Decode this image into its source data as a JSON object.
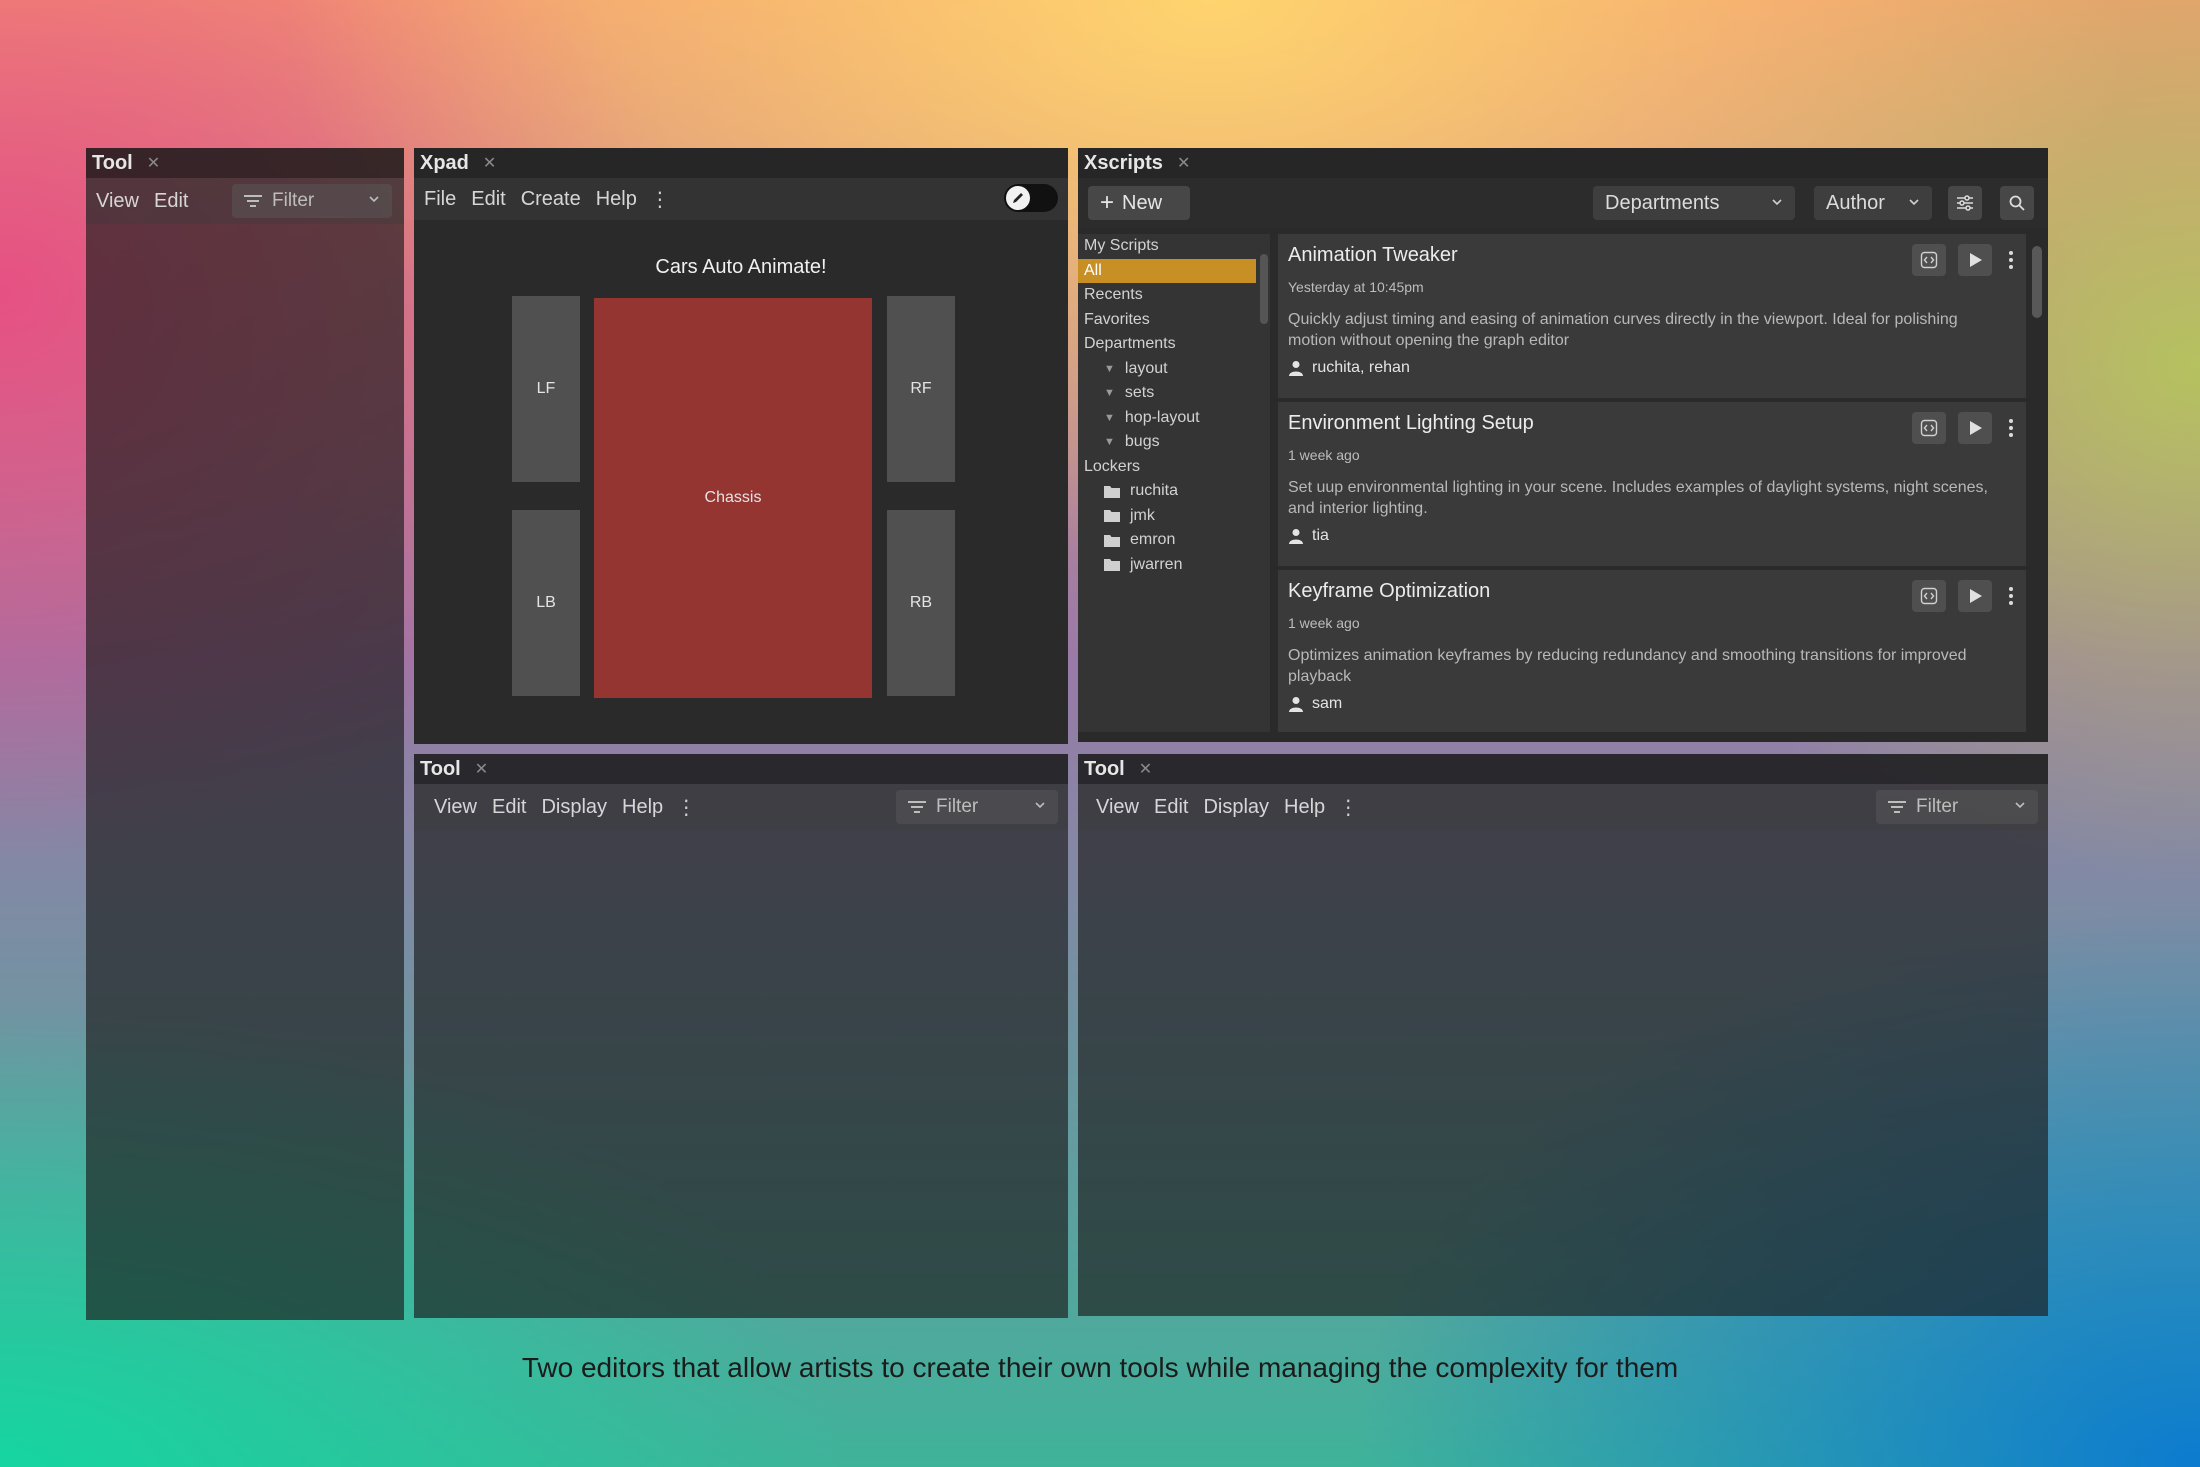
{
  "tool_left": {
    "title": "Tool",
    "menu": [
      "View",
      "Edit"
    ],
    "filter_label": "Filter"
  },
  "xpad": {
    "title": "Xpad",
    "menu": [
      "File",
      "Edit",
      "Create",
      "Help"
    ],
    "canvas_title": "Cars Auto Animate!",
    "wheels": {
      "lf": "LF",
      "rf": "RF",
      "lb": "LB",
      "rb": "RB"
    },
    "chassis": "Chassis",
    "chassis_color": "#943532"
  },
  "xscripts": {
    "title": "Xscripts",
    "new_label": "New",
    "departments_label": "Departments",
    "author_label": "Author",
    "accent_color": "#c88f24",
    "sidebar": {
      "my_scripts": "My Scripts",
      "all": "All",
      "recents": "Recents",
      "favorites": "Favorites",
      "departments": "Departments",
      "department_items": [
        "layout",
        "sets",
        "hop-layout",
        "bugs"
      ],
      "lockers": "Lockers",
      "locker_items": [
        "ruchita",
        "jmk",
        "emron",
        "jwarren"
      ]
    },
    "scripts": [
      {
        "title": "Animation Tweaker",
        "time": "Yesterday at 10:45pm",
        "description": "Quickly adjust timing and easing of animation curves directly in the viewport. Ideal for polishing motion without opening the graph editor",
        "authors": "ruchita, rehan"
      },
      {
        "title": "Environment Lighting Setup",
        "time": "1 week ago",
        "description": "Set uup environmental lighting in your scene. Includes examples of daylight systems, night scenes, and interior lighting.",
        "authors": "tia"
      },
      {
        "title": "Keyframe Optimization",
        "time": "1 week ago",
        "description": "Optimizes animation keyframes by reducing redundancy and smoothing transitions for improved playback",
        "authors": "sam"
      }
    ]
  },
  "tool_bottom_left": {
    "title": "Tool",
    "menu": [
      "View",
      "Edit",
      "Display",
      "Help"
    ],
    "filter_label": "Filter"
  },
  "tool_bottom_right": {
    "title": "Tool",
    "menu": [
      "View",
      "Edit",
      "Display",
      "Help"
    ],
    "filter_label": "Filter"
  },
  "caption": "Two editors that allow artists to create their own tools while managing the complexity for them"
}
